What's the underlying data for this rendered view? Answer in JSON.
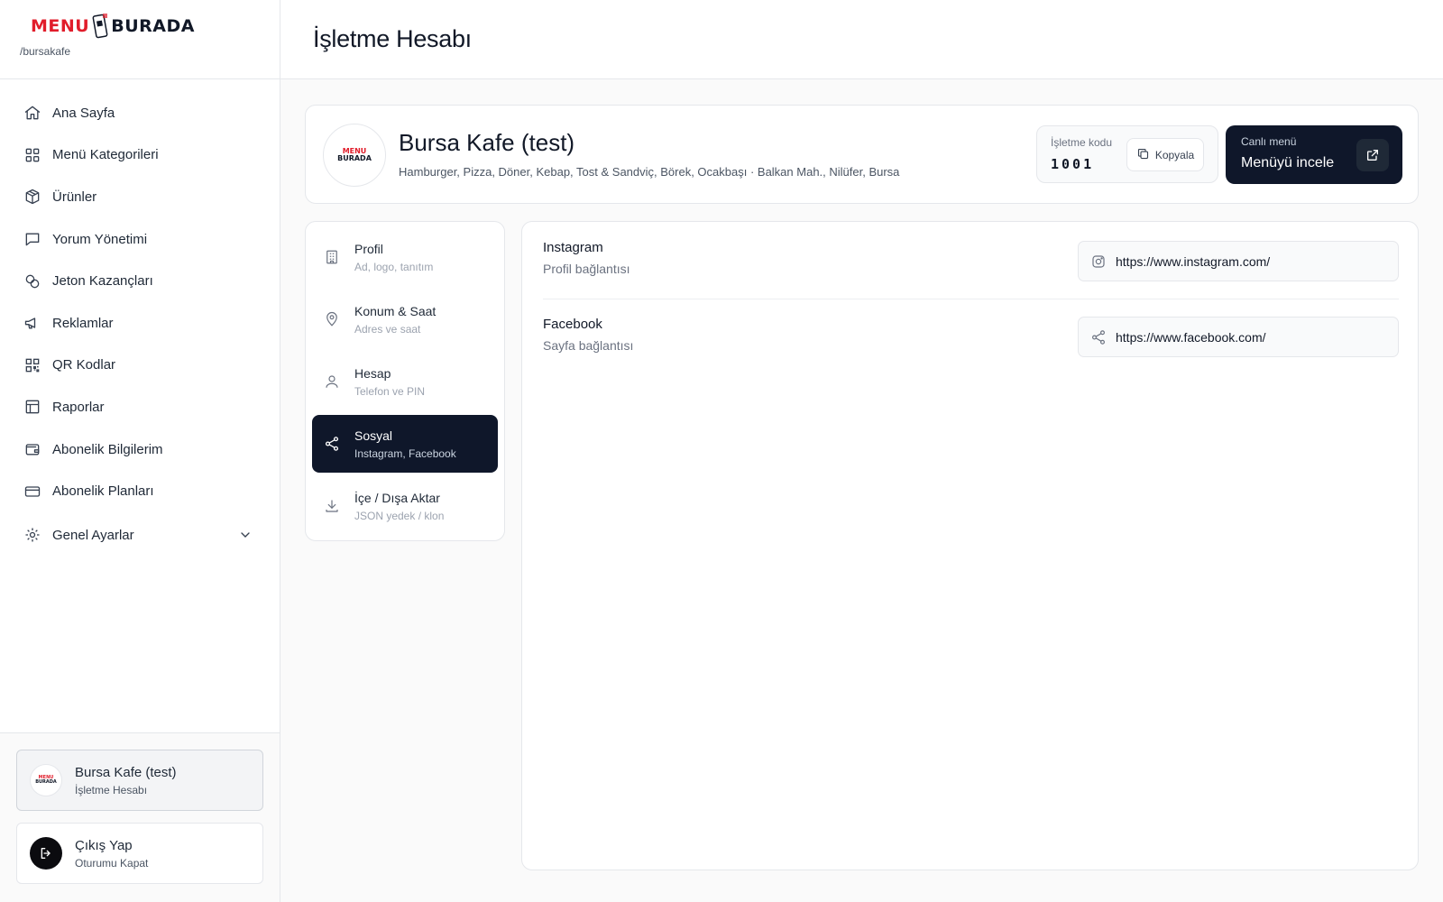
{
  "brand": {
    "logo_left": "MENU",
    "logo_right": "BURADA",
    "slug": "/bursakafe"
  },
  "header": {
    "title": "İşletme Hesabı"
  },
  "sidebar": {
    "items": [
      {
        "label": "Ana Sayfa",
        "icon": "home-icon"
      },
      {
        "label": "Menü Kategorileri",
        "icon": "grid-icon"
      },
      {
        "label": "Ürünler",
        "icon": "box-icon"
      },
      {
        "label": "Yorum Yönetimi",
        "icon": "message-icon"
      },
      {
        "label": "Jeton Kazançları",
        "icon": "coins-icon"
      },
      {
        "label": "Reklamlar",
        "icon": "megaphone-icon"
      },
      {
        "label": "QR Kodlar",
        "icon": "qr-icon"
      },
      {
        "label": "Raporlar",
        "icon": "layout-icon"
      },
      {
        "label": "Abonelik Bilgilerim",
        "icon": "wallet-icon"
      },
      {
        "label": "Abonelik Planları",
        "icon": "card-icon"
      },
      {
        "label": "Genel Ayarlar",
        "icon": "gear-icon"
      }
    ],
    "account": {
      "name": "Bursa Kafe (test)",
      "sub": "İşletme Hesabı"
    },
    "logout": {
      "title": "Çıkış Yap",
      "sub": "Oturumu Kapat"
    }
  },
  "business": {
    "name": "Bursa Kafe (test)",
    "description": "Hamburger, Pizza, Döner, Kebap, Tost & Sandviç, Börek, Ocakbaşı · Balkan Mah., Nilüfer, Bursa",
    "code_label": "İşletme kodu",
    "code_value": "1001",
    "copy_label": "Kopyala",
    "live_label": "Canlı menü",
    "live_title": "Menüyü incele"
  },
  "tabs": [
    {
      "title": "Profil",
      "sub": "Ad, logo, tanıtım",
      "icon": "building-icon",
      "active": false
    },
    {
      "title": "Konum & Saat",
      "sub": "Adres ve saat",
      "icon": "map-pin-icon",
      "active": false
    },
    {
      "title": "Hesap",
      "sub": "Telefon ve PIN",
      "icon": "user-icon",
      "active": false
    },
    {
      "title": "Sosyal",
      "sub": "Instagram, Facebook",
      "icon": "share-icon",
      "active": true
    },
    {
      "title": "İçe / Dışa Aktar",
      "sub": "JSON yedek / klon",
      "icon": "download-icon",
      "active": false
    }
  ],
  "social": {
    "instagram": {
      "title": "Instagram",
      "sub": "Profil bağlantısı",
      "value": "https://www.instagram.com/"
    },
    "facebook": {
      "title": "Facebook",
      "sub": "Sayfa bağlantısı",
      "value": "https://www.facebook.com/"
    }
  },
  "colors": {
    "accent": "#0f172a",
    "brand_red": "#e11d2b",
    "background": "#fafafa"
  }
}
